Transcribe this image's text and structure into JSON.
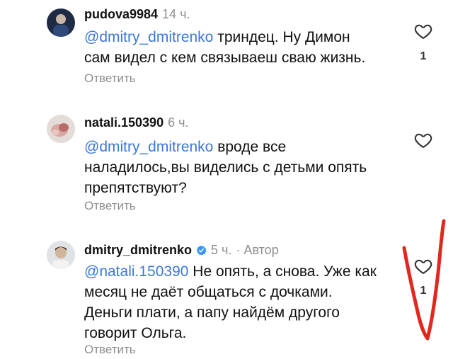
{
  "comments": [
    {
      "username": "pudova9984",
      "time": "14 ч.",
      "mention": "@dmitry_dmitrenko",
      "body_line1": " триндец. Ну Димон",
      "body_line2": "сам видел с кем связываеш сваю жизнь.",
      "reply": "Ответить",
      "likes": "1",
      "avatar_icon": "profile-photo-icon"
    },
    {
      "username": "natali.150390",
      "time": "6 ч.",
      "mention": "@dmitry_dmitrenko",
      "body_line1": " вроде все",
      "body_line2": "наладилось,вы виделись с детьми опять",
      "body_line3": "препятствуют?",
      "reply": "Ответить",
      "avatar_icon": "profile-photo-icon"
    },
    {
      "username": "dmitry_dmitrenko",
      "time": "5 ч.",
      "author_label": "· Автор",
      "mention": "@natali.150390",
      "body_line1": " Не опять, а снова. Уже как",
      "body_line2": "месяц не даёт общаться с дочками.",
      "body_line3": "Деньги плати, а папу найдём другого",
      "body_line4": "говорит Ольга.",
      "reply": "Ответить",
      "likes": "1",
      "avatar_icon": "profile-photo-icon",
      "verified_icon": "verified-badge-icon"
    }
  ],
  "colors": {
    "mention": "#3a78d8",
    "secondary_text": "#8e8e8e",
    "verified": "#3897f0",
    "annotation_stroke": "#e0281e"
  },
  "icons": {
    "like": "heart-outline-icon",
    "annotation": "red-checkmark-drawing"
  }
}
